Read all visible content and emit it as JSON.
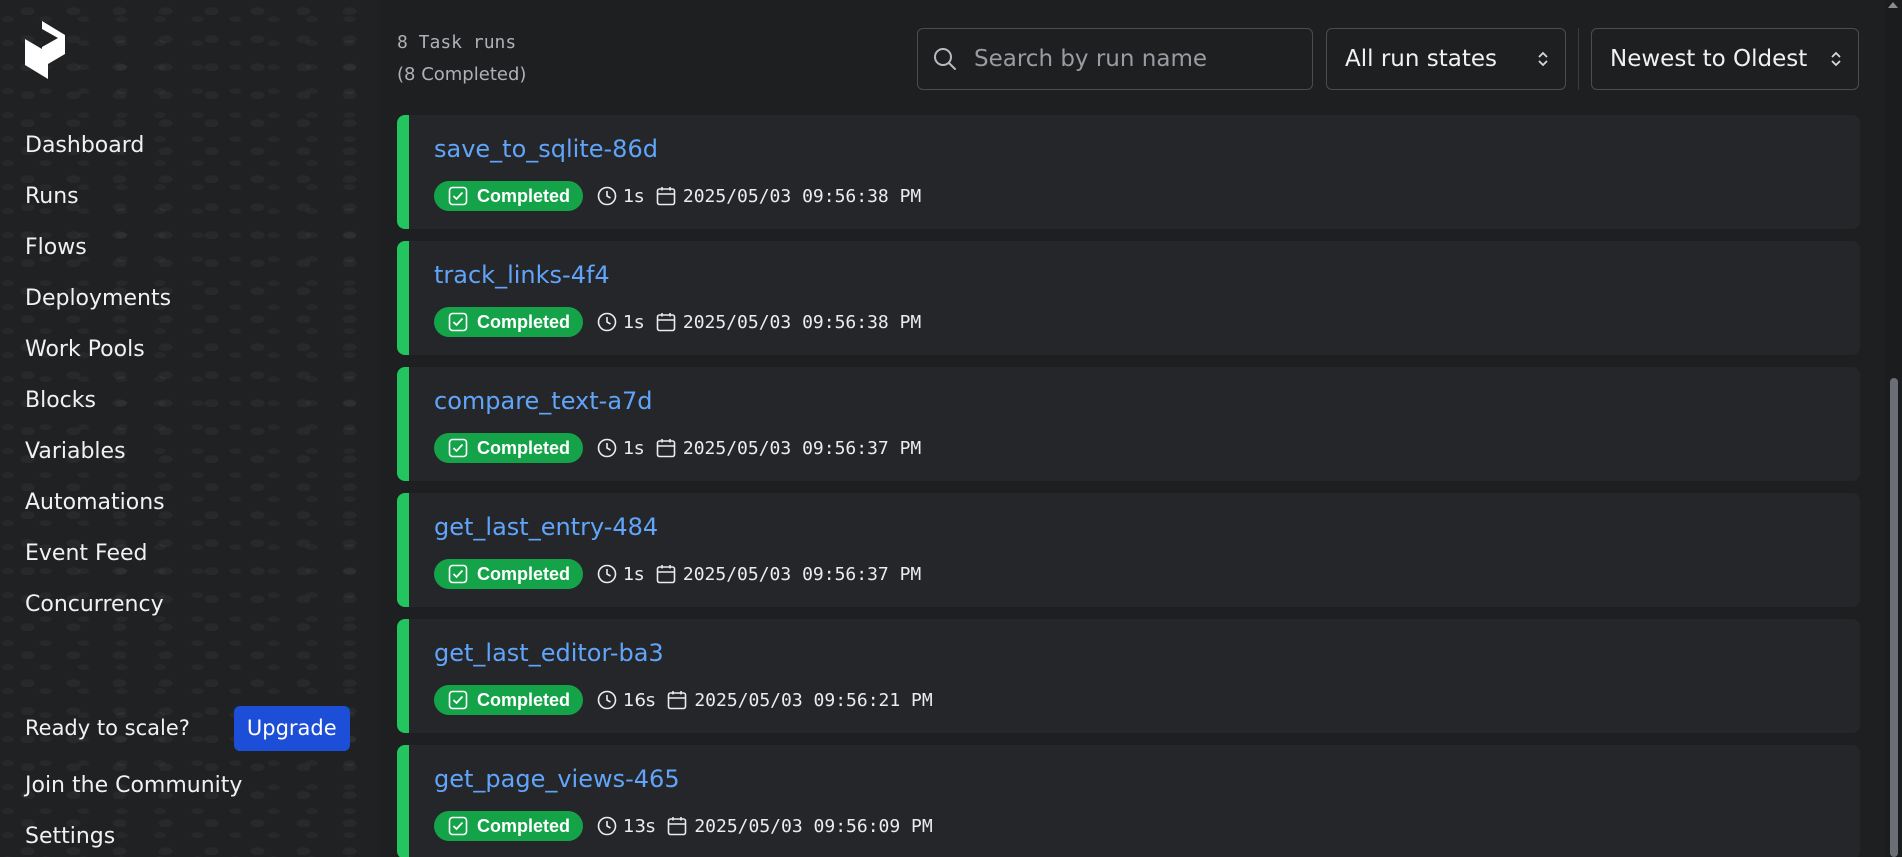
{
  "sidebar": {
    "nav": [
      {
        "label": "Dashboard"
      },
      {
        "label": "Runs"
      },
      {
        "label": "Flows"
      },
      {
        "label": "Deployments"
      },
      {
        "label": "Work Pools"
      },
      {
        "label": "Blocks"
      },
      {
        "label": "Variables"
      },
      {
        "label": "Automations"
      },
      {
        "label": "Event Feed"
      },
      {
        "label": "Concurrency"
      }
    ],
    "scale_prompt": "Ready to scale?",
    "upgrade_label": "Upgrade",
    "community_label": "Join the Community",
    "settings_label": "Settings"
  },
  "header": {
    "count_label": "8 Task runs",
    "count_detail": "(8 Completed)",
    "search_placeholder": "Search by run name",
    "state_filter": "All run states",
    "sort_order": "Newest to Oldest"
  },
  "runs": [
    {
      "name": "save_to_sqlite-86d",
      "state": "Completed",
      "duration": "1s",
      "timestamp": "2025/05/03 09:56:38 PM"
    },
    {
      "name": "track_links-4f4",
      "state": "Completed",
      "duration": "1s",
      "timestamp": "2025/05/03 09:56:38 PM"
    },
    {
      "name": "compare_text-a7d",
      "state": "Completed",
      "duration": "1s",
      "timestamp": "2025/05/03 09:56:37 PM"
    },
    {
      "name": "get_last_entry-484",
      "state": "Completed",
      "duration": "1s",
      "timestamp": "2025/05/03 09:56:37 PM"
    },
    {
      "name": "get_last_editor-ba3",
      "state": "Completed",
      "duration": "16s",
      "timestamp": "2025/05/03 09:56:21 PM"
    },
    {
      "name": "get_page_views-465",
      "state": "Completed",
      "duration": "13s",
      "timestamp": "2025/05/03 09:56:09 PM"
    }
  ],
  "colors": {
    "completed": "#15a34a",
    "stripe": "#22c55e",
    "link": "#60a5fa",
    "upgrade": "#1d4ed8"
  }
}
